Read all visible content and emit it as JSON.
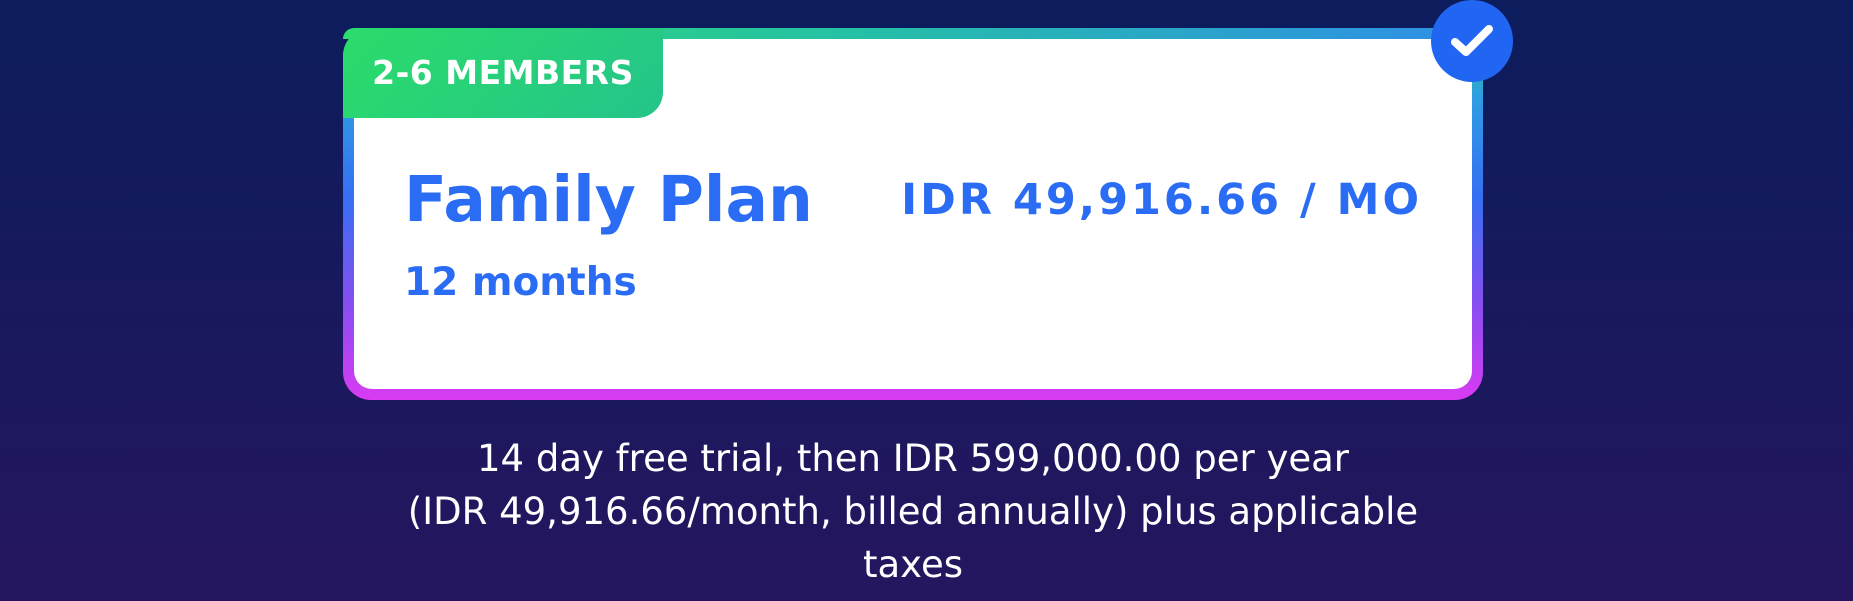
{
  "plan": {
    "members_badge": "2-6 MEMBERS",
    "name": "Family Plan",
    "duration": "12 months",
    "price": "IDR 49,916.66 / MO",
    "selected_icon": "checkmark-icon"
  },
  "trial": {
    "line1": "14 day free trial, then IDR 599,000.00 per year",
    "line2": "(IDR 49,916.66/month, billed annually) plus applicable",
    "line3": "taxes"
  },
  "colors": {
    "background_top": "#0c1c5c",
    "background_bottom": "#25165f",
    "accent_blue": "#2a6cf3",
    "badge_green": "#2bdc6a",
    "border_magenta": "#d93bf2",
    "check_blue": "#2166f2"
  }
}
